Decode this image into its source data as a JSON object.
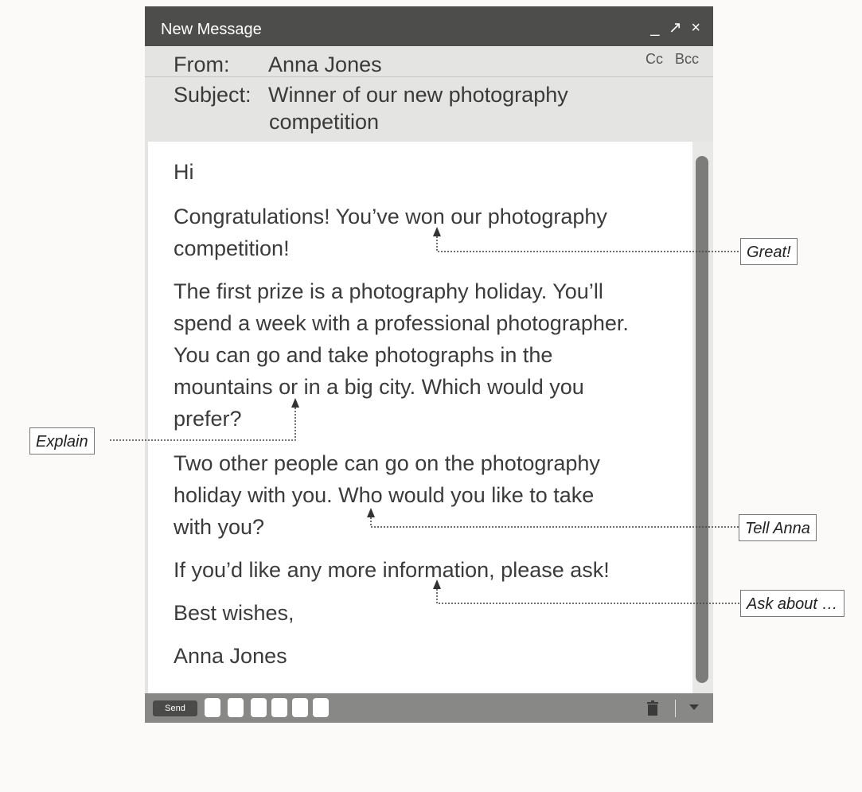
{
  "window": {
    "title": "New Message",
    "controls": {
      "minimize": "_",
      "popout": "↗",
      "close": "×"
    }
  },
  "header": {
    "from_label": "From:",
    "from_value": "Anna Jones",
    "cc": "Cc",
    "bcc": "Bcc",
    "subject_label": "Subject:",
    "subject_line1": "Winner of our new photography",
    "subject_line2": "competition"
  },
  "body": {
    "greeting": "Hi",
    "p1_l1": "Congratulations! You’ve won our photography",
    "p1_l2": "competition!",
    "p2_l1": "The first prize is a photography holiday. You’ll",
    "p2_l2": "spend a week with a professional photographer.",
    "p2_l3": "You can go and take photographs in the",
    "p2_l4": "mountains or in a big city. Which would you",
    "p2_l5": "prefer?",
    "p3_l1": "Two other people can go on the photography",
    "p3_l2": "holiday with you. Who would you like to take",
    "p3_l3": "with you?",
    "p4": "If you’d like any more information, please ask!",
    "signoff": "Best wishes,",
    "signature": "Anna Jones"
  },
  "toolbar": {
    "send_label": "Send",
    "icons": [
      "trash-icon",
      "more-options-icon"
    ]
  },
  "annotations": {
    "great": "Great!",
    "explain": "Explain",
    "tell_anna": "Tell Anna",
    "ask_about": "Ask about …"
  },
  "colors": {
    "titlebar": "#4d4d4b",
    "window_chrome": "#e4e4e2",
    "body_bg": "#ffffff",
    "scroll_thumb": "#7c7c7a",
    "text": "#3b3b3b"
  }
}
